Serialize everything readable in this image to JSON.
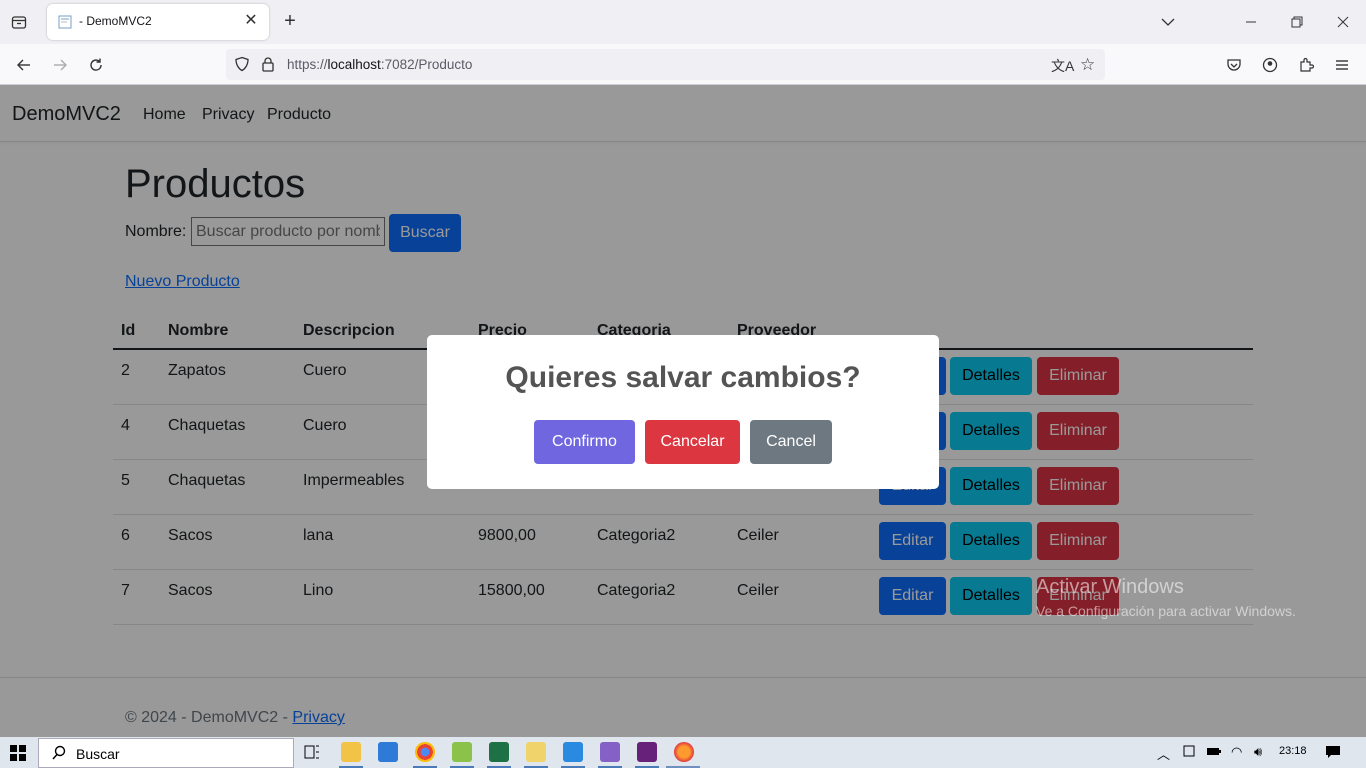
{
  "browser": {
    "tab_title": "- DemoMVC2",
    "url_prefix": "https://",
    "url_host": "localhost",
    "url_rest": ":7082/Producto"
  },
  "site": {
    "brand": "DemoMVC2",
    "nav": [
      "Home",
      "Privacy",
      "Producto"
    ]
  },
  "main": {
    "title": "Productos",
    "search_label": "Nombre:",
    "search_placeholder": "Buscar producto por nombre",
    "search_button": "Buscar",
    "new_link": "Nuevo Producto",
    "columns": [
      "Id",
      "Nombre",
      "Descripcion",
      "Precio",
      "Categoria",
      "Proveedor"
    ],
    "rows": [
      {
        "id": "2",
        "nombre": "Zapatos",
        "descripcion": "Cuero",
        "precio": "",
        "categoria": "",
        "proveedor": ""
      },
      {
        "id": "4",
        "nombre": "Chaquetas",
        "descripcion": "Cuero",
        "precio": "",
        "categoria": "",
        "proveedor": ""
      },
      {
        "id": "5",
        "nombre": "Chaquetas",
        "descripcion": "Impermeables",
        "precio": "",
        "categoria": "",
        "proveedor": ""
      },
      {
        "id": "6",
        "nombre": "Sacos",
        "descripcion": "lana",
        "precio": "9800,00",
        "categoria": "Categoria2",
        "proveedor": "Ceiler"
      },
      {
        "id": "7",
        "nombre": "Sacos",
        "descripcion": "Lino",
        "precio": "15800,00",
        "categoria": "Categoria2",
        "proveedor": "Ceiler"
      }
    ],
    "row_actions": {
      "edit": "Editar",
      "details": "Detalles",
      "delete": "Eliminar"
    }
  },
  "footer": {
    "text": "© 2024 - DemoMVC2 - ",
    "link": "Privacy"
  },
  "watermark": {
    "line1": "Activar Windows",
    "line2": "Ve a Configuración para activar Windows."
  },
  "modal": {
    "title": "Quieres salvar cambios?",
    "confirm": "Confirmo",
    "deny": "Cancelar",
    "cancel": "Cancel"
  },
  "taskbar": {
    "search_text": "Buscar",
    "time": "23:18"
  },
  "colors": {
    "primary": "#0d6efd",
    "info": "#0dcaf0",
    "danger": "#dc3545",
    "confirm": "#7066e0",
    "deny": "#dc3741",
    "cancel": "#6e7881"
  }
}
